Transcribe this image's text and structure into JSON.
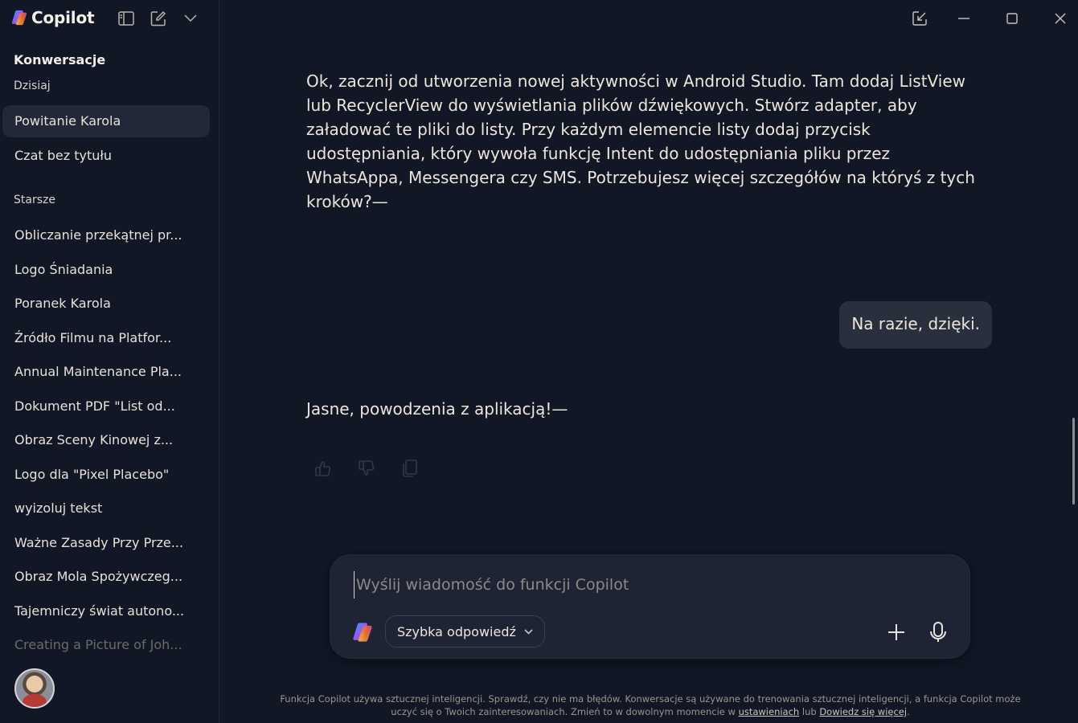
{
  "app": {
    "name": "Copilot"
  },
  "sidebar": {
    "section_title": "Konwersacje",
    "today_label": "Dzisiaj",
    "today_items": [
      {
        "label": "Powitanie Karola",
        "active": true
      },
      {
        "label": "Czat bez tytułu",
        "active": false
      }
    ],
    "older_label": "Starsze",
    "older_items": [
      {
        "label": "Obliczanie przekątnej pr..."
      },
      {
        "label": "Logo Śniadania"
      },
      {
        "label": "Poranek Karola"
      },
      {
        "label": "Źródło Filmu na Platfor..."
      },
      {
        "label": "Annual Maintenance Pla..."
      },
      {
        "label": "Dokument PDF \"List od..."
      },
      {
        "label": "Obraz Sceny Kinowej z..."
      },
      {
        "label": "Logo dla \"Pixel Placebo\""
      },
      {
        "label": "wyizoluj tekst"
      },
      {
        "label": "Ważne Zasady Przy Prze..."
      },
      {
        "label": "Obraz Mola Spożywczeg..."
      },
      {
        "label": "Tajemniczy świat autono..."
      },
      {
        "label": "Creating a Picture of Joh..."
      }
    ]
  },
  "chat": {
    "assistant_message_1": "Ok, zacznij od utworzenia nowej aktywności w Android Studio. Tam dodaj ListView lub RecyclerView do wyświetlania plików dźwiękowych. Stwórz adapter, aby załadować te pliki do listy. Przy każdym elemencie listy dodaj przycisk udostępniania, który wywoła funkcję Intent do udostępniania pliku przez WhatsAppa, Messengera czy SMS. Potrzebujesz więcej szczegółów na któryś z tych kroków?—",
    "user_message": "Na razie, dzięki.",
    "assistant_message_2": "Jasne, powodzenia z aplikacją!—"
  },
  "composer": {
    "placeholder": "Wyślij wiadomość do funkcji Copilot",
    "value": "",
    "mode_label": "Szybka odpowiedź"
  },
  "footer": {
    "disclaimer_text": "Funkcja Copilot używa sztucznej inteligencji. Sprawdź, czy nie ma błędów. Konwersacje są używane do trenowania sztucznej inteligencji, a funkcja Copilot może uczyć się o Twoich zainteresowaniach. Zmień to w dowolnym momencie w",
    "settings_link": "ustawieniach",
    "connector": "lub",
    "learn_more_link": "Dowiedz się więcej",
    "end": "."
  },
  "colors": {
    "background": "#121726",
    "active_item": "#232838",
    "composer": "#1f2434",
    "user_bubble": "#2a2f3e"
  }
}
